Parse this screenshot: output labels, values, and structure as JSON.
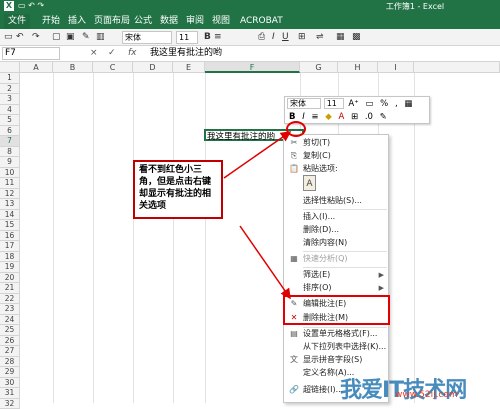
{
  "window": {
    "title": "工作簿1 - Excel",
    "app_icon": "X"
  },
  "ribbon": {
    "tabs": [
      "文件",
      "开始",
      "插入",
      "页面布局",
      "公式",
      "数据",
      "审阅",
      "视图",
      "ACROBAT"
    ]
  },
  "toolbar": {
    "font_name": "宋体",
    "font_size": "11",
    "bold": "B",
    "italic": "I",
    "underline": "U"
  },
  "formula_bar": {
    "name_box": "F7",
    "fx": "fx",
    "cancel": "×",
    "confirm": "✓",
    "value": "我这里有批注的哟"
  },
  "grid": {
    "columns": [
      "A",
      "B",
      "C",
      "D",
      "E",
      "F",
      "G",
      "H",
      "I"
    ],
    "rows": [
      "1",
      "2",
      "3",
      "4",
      "5",
      "6",
      "7",
      "8",
      "9",
      "10",
      "11",
      "12",
      "13",
      "14",
      "15",
      "16",
      "17",
      "18",
      "19",
      "20",
      "21",
      "22",
      "23",
      "24",
      "25",
      "26",
      "27",
      "28",
      "29",
      "30",
      "31",
      "32"
    ],
    "selected_cell_text": "我这里有批注的哟"
  },
  "mini_toolbar": {
    "font_name": "宋体",
    "font_size": "11",
    "percent": "%",
    "comma": ",",
    "bold": "B",
    "italic": "I"
  },
  "context_menu": {
    "items": [
      {
        "label": "剪切(T)",
        "icon": "scissors-icon",
        "glyph": "✂",
        "disabled": false
      },
      {
        "label": "复制(C)",
        "icon": "copy-icon",
        "glyph": "⎘",
        "disabled": false
      },
      {
        "label": "粘贴选项:",
        "icon": "paste-icon",
        "glyph": "📋",
        "disabled": false
      },
      {
        "label": "选择性粘贴(S)...",
        "icon": "",
        "glyph": "",
        "disabled": false
      },
      {
        "label": "插入(I)...",
        "icon": "",
        "glyph": "",
        "disabled": false
      },
      {
        "label": "删除(D)...",
        "icon": "",
        "glyph": "",
        "disabled": false
      },
      {
        "label": "清除内容(N)",
        "icon": "",
        "glyph": "",
        "disabled": false
      },
      {
        "label": "快速分析(Q)",
        "icon": "quick-analysis-icon",
        "glyph": "▦",
        "disabled": true
      },
      {
        "label": "筛选(E)",
        "icon": "",
        "glyph": "",
        "disabled": false
      },
      {
        "label": "排序(O)",
        "icon": "",
        "glyph": "",
        "disabled": false
      },
      {
        "label": "编辑批注(E)",
        "icon": "edit-comment-icon",
        "glyph": "✎",
        "disabled": false
      },
      {
        "label": "删除批注(M)",
        "icon": "delete-comment-icon",
        "glyph": "✕",
        "disabled": false
      },
      {
        "label": "设置单元格格式(F)...",
        "icon": "format-cells-icon",
        "glyph": "▤",
        "disabled": false
      },
      {
        "label": "从下拉列表中选择(K)...",
        "icon": "",
        "glyph": "",
        "disabled": false
      },
      {
        "label": "显示拼音字段(S)",
        "icon": "phonetic-icon",
        "glyph": "文",
        "disabled": false
      },
      {
        "label": "定义名称(A)...",
        "icon": "",
        "glyph": "",
        "disabled": false
      },
      {
        "label": "超链接(I)...",
        "icon": "hyperlink-icon",
        "glyph": "🔗",
        "disabled": false
      }
    ],
    "paste_glyph": "A"
  },
  "annotation": {
    "callout_text": "看不到红色小三角，但是点击右键却显示有批注的相关选项"
  },
  "watermark": {
    "text": "我爱IT技术网",
    "url": "www.52ij.com"
  },
  "colors": {
    "accent": "#217346",
    "highlight_red": "#e00000",
    "watermark_blue": "#0b66a8"
  }
}
